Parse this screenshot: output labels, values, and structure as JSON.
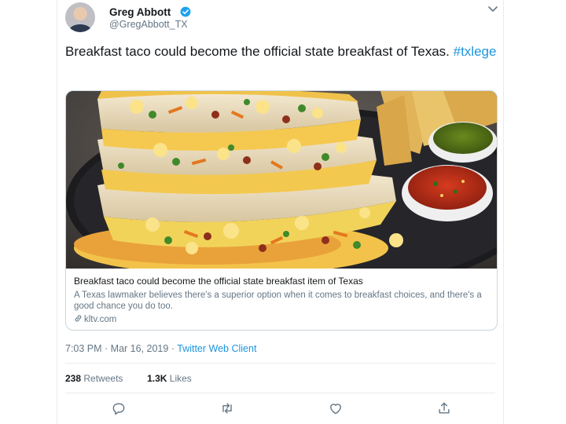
{
  "author": {
    "name": "Greg Abbott",
    "handle": "@GregAbbott_TX",
    "verified": true
  },
  "tweet": {
    "text": "Breakfast taco could become the official state breakfast of Texas.",
    "hashtag": "#txlege"
  },
  "card": {
    "image": "breakfast-tacos-photo",
    "title": "Breakfast taco could become the official state breakfast item of Texas",
    "description": "A Texas lawmaker believes there's a superior option when it comes to breakfast choices, and there's a good chance you do too.",
    "link": "kltv.com"
  },
  "meta": {
    "time": "7:03 PM",
    "separator": " · ",
    "date": "Mar 16, 2019",
    "source": "Twitter Web Client"
  },
  "stats": {
    "retweets_count": "238",
    "retweets_label": "Retweets",
    "likes_count": "1.3K",
    "likes_label": "Likes"
  },
  "actions": [
    "reply-icon",
    "retweet-icon",
    "like-icon",
    "share-icon"
  ],
  "colors": {
    "link": "#1b95e0",
    "secondary_text": "#657786",
    "border": "#ccd6dd",
    "verified": "#1da1f2"
  }
}
